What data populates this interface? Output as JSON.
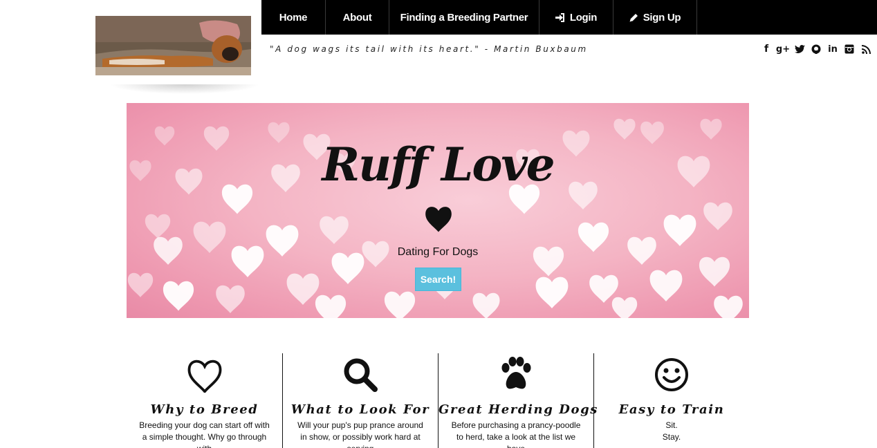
{
  "logo": {
    "alt": "boxer dog lying on a couch"
  },
  "nav": {
    "items": [
      {
        "label": "Home",
        "icon": ""
      },
      {
        "label": "About",
        "icon": ""
      },
      {
        "label": "Finding a Breeding Partner",
        "icon": ""
      },
      {
        "label": "Login",
        "icon": "sign-in-icon"
      },
      {
        "label": "Sign Up",
        "icon": "pencil-icon"
      }
    ]
  },
  "quote": "\"A dog wags its tail with its heart.\" - Martin Buxbaum",
  "social": [
    "facebook-icon",
    "google-plus-icon",
    "twitter-icon",
    "github-icon",
    "linkedin-icon",
    "instagram-icon",
    "rss-icon"
  ],
  "hero": {
    "title": "Ruff Love",
    "subtitle": "Dating For Dogs",
    "button": "Search!"
  },
  "features": [
    {
      "icon": "heart-outline-icon",
      "title": "Why to Breed",
      "text": "Breeding your dog can start off with a simple thought. Why go through with"
    },
    {
      "icon": "magnifier-icon",
      "title": "What to Look For",
      "text": "Will your pup's pup prance around in show, or possibly work hard at serving"
    },
    {
      "icon": "paw-icon",
      "title": "Great Herding Dogs",
      "text": "Before purchasing a prancy-poodle to herd, take a look at the list we have"
    },
    {
      "icon": "smiley-icon",
      "title": "Easy to Train",
      "lines": [
        "Sit.",
        "Stay."
      ]
    }
  ],
  "colors": {
    "nav_bg": "#000000",
    "button": "#5bc0de",
    "hero_pink": "#f4b4c4"
  }
}
